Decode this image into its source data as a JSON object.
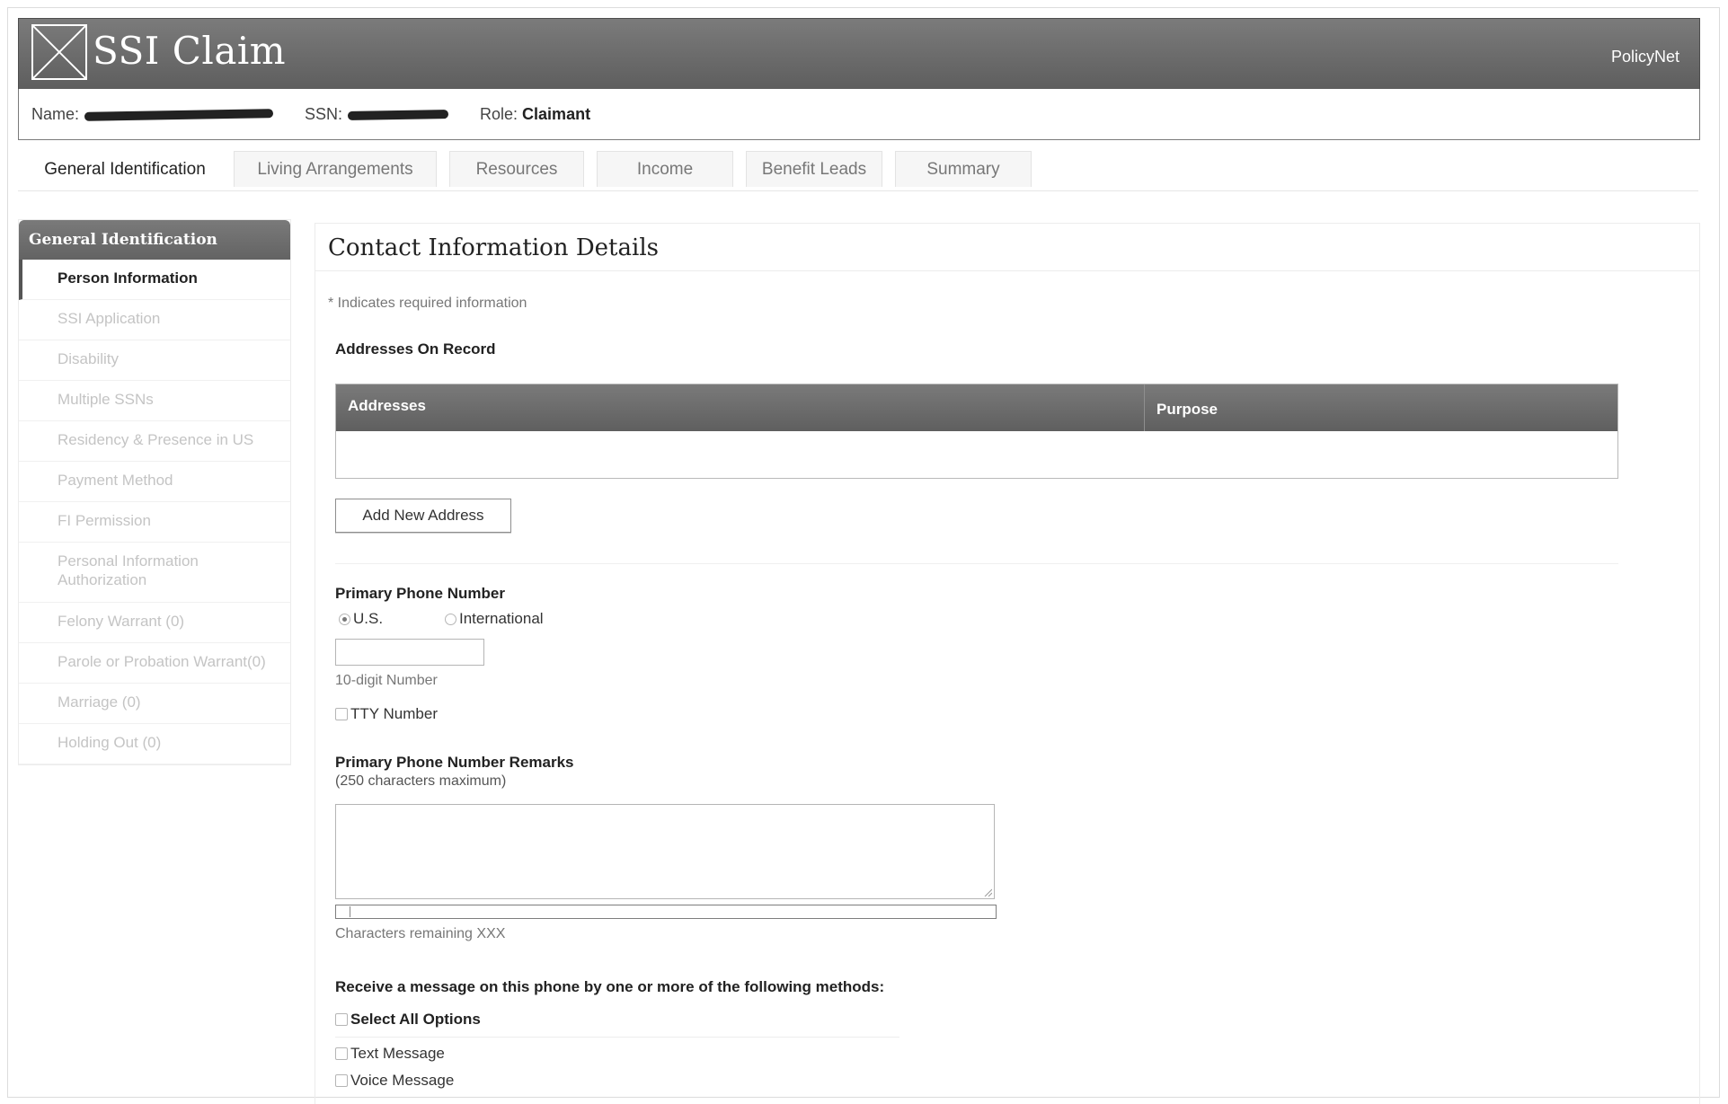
{
  "header": {
    "title": "SSI Claim",
    "policynet": "PolicyNet"
  },
  "info": {
    "name_label": "Name:",
    "ssn_label": "SSN:",
    "role_label": "Role:",
    "role_value": "Claimant"
  },
  "tabs": [
    {
      "label": "General Identification",
      "active": true
    },
    {
      "label": "Living Arrangements",
      "active": false
    },
    {
      "label": "Resources",
      "active": false
    },
    {
      "label": "Income",
      "active": false
    },
    {
      "label": "Benefit Leads",
      "active": false
    },
    {
      "label": "Summary",
      "active": false
    }
  ],
  "sidebar": {
    "header": "General Identification",
    "items": [
      {
        "label": "Person Information",
        "active": true
      },
      {
        "label": "SSI Application"
      },
      {
        "label": "Disability"
      },
      {
        "label": "Multiple SSNs"
      },
      {
        "label": "Residency & Presence in US"
      },
      {
        "label": "Payment Method"
      },
      {
        "label": "FI Permission"
      },
      {
        "label": "Personal Information Authorization"
      },
      {
        "label": "Felony Warrant (0)"
      },
      {
        "label": "Parole or Probation Warrant(0)"
      },
      {
        "label": "Marriage (0)"
      },
      {
        "label": "Holding Out (0)"
      }
    ]
  },
  "main": {
    "title": "Contact Information Details",
    "required_note": "* Indicates required information",
    "addresses_heading": "Addresses On Record",
    "table": {
      "col_addresses": "Addresses",
      "col_purpose": "Purpose"
    },
    "add_address_button": "Add New Address",
    "phone_heading": "Primary Phone Number",
    "radio_us": "U.S.",
    "radio_international": "International",
    "phone_hint": "10-digit Number",
    "tty_label": "TTY Number",
    "remarks_heading": "Primary Phone Number Remarks",
    "remarks_sub": "(250 characters maximum)",
    "remaining_label": "Characters remaining  XXX",
    "methods_heading": "Receive a message on this phone by one or more of the following methods:",
    "select_all": "Select All Options",
    "text_message": "Text Message",
    "voice_message": "Voice Message"
  },
  "colors": {
    "header_bg": "#6b6b6b",
    "active_text": "#222222",
    "inactive_text": "#c4c4c4"
  }
}
